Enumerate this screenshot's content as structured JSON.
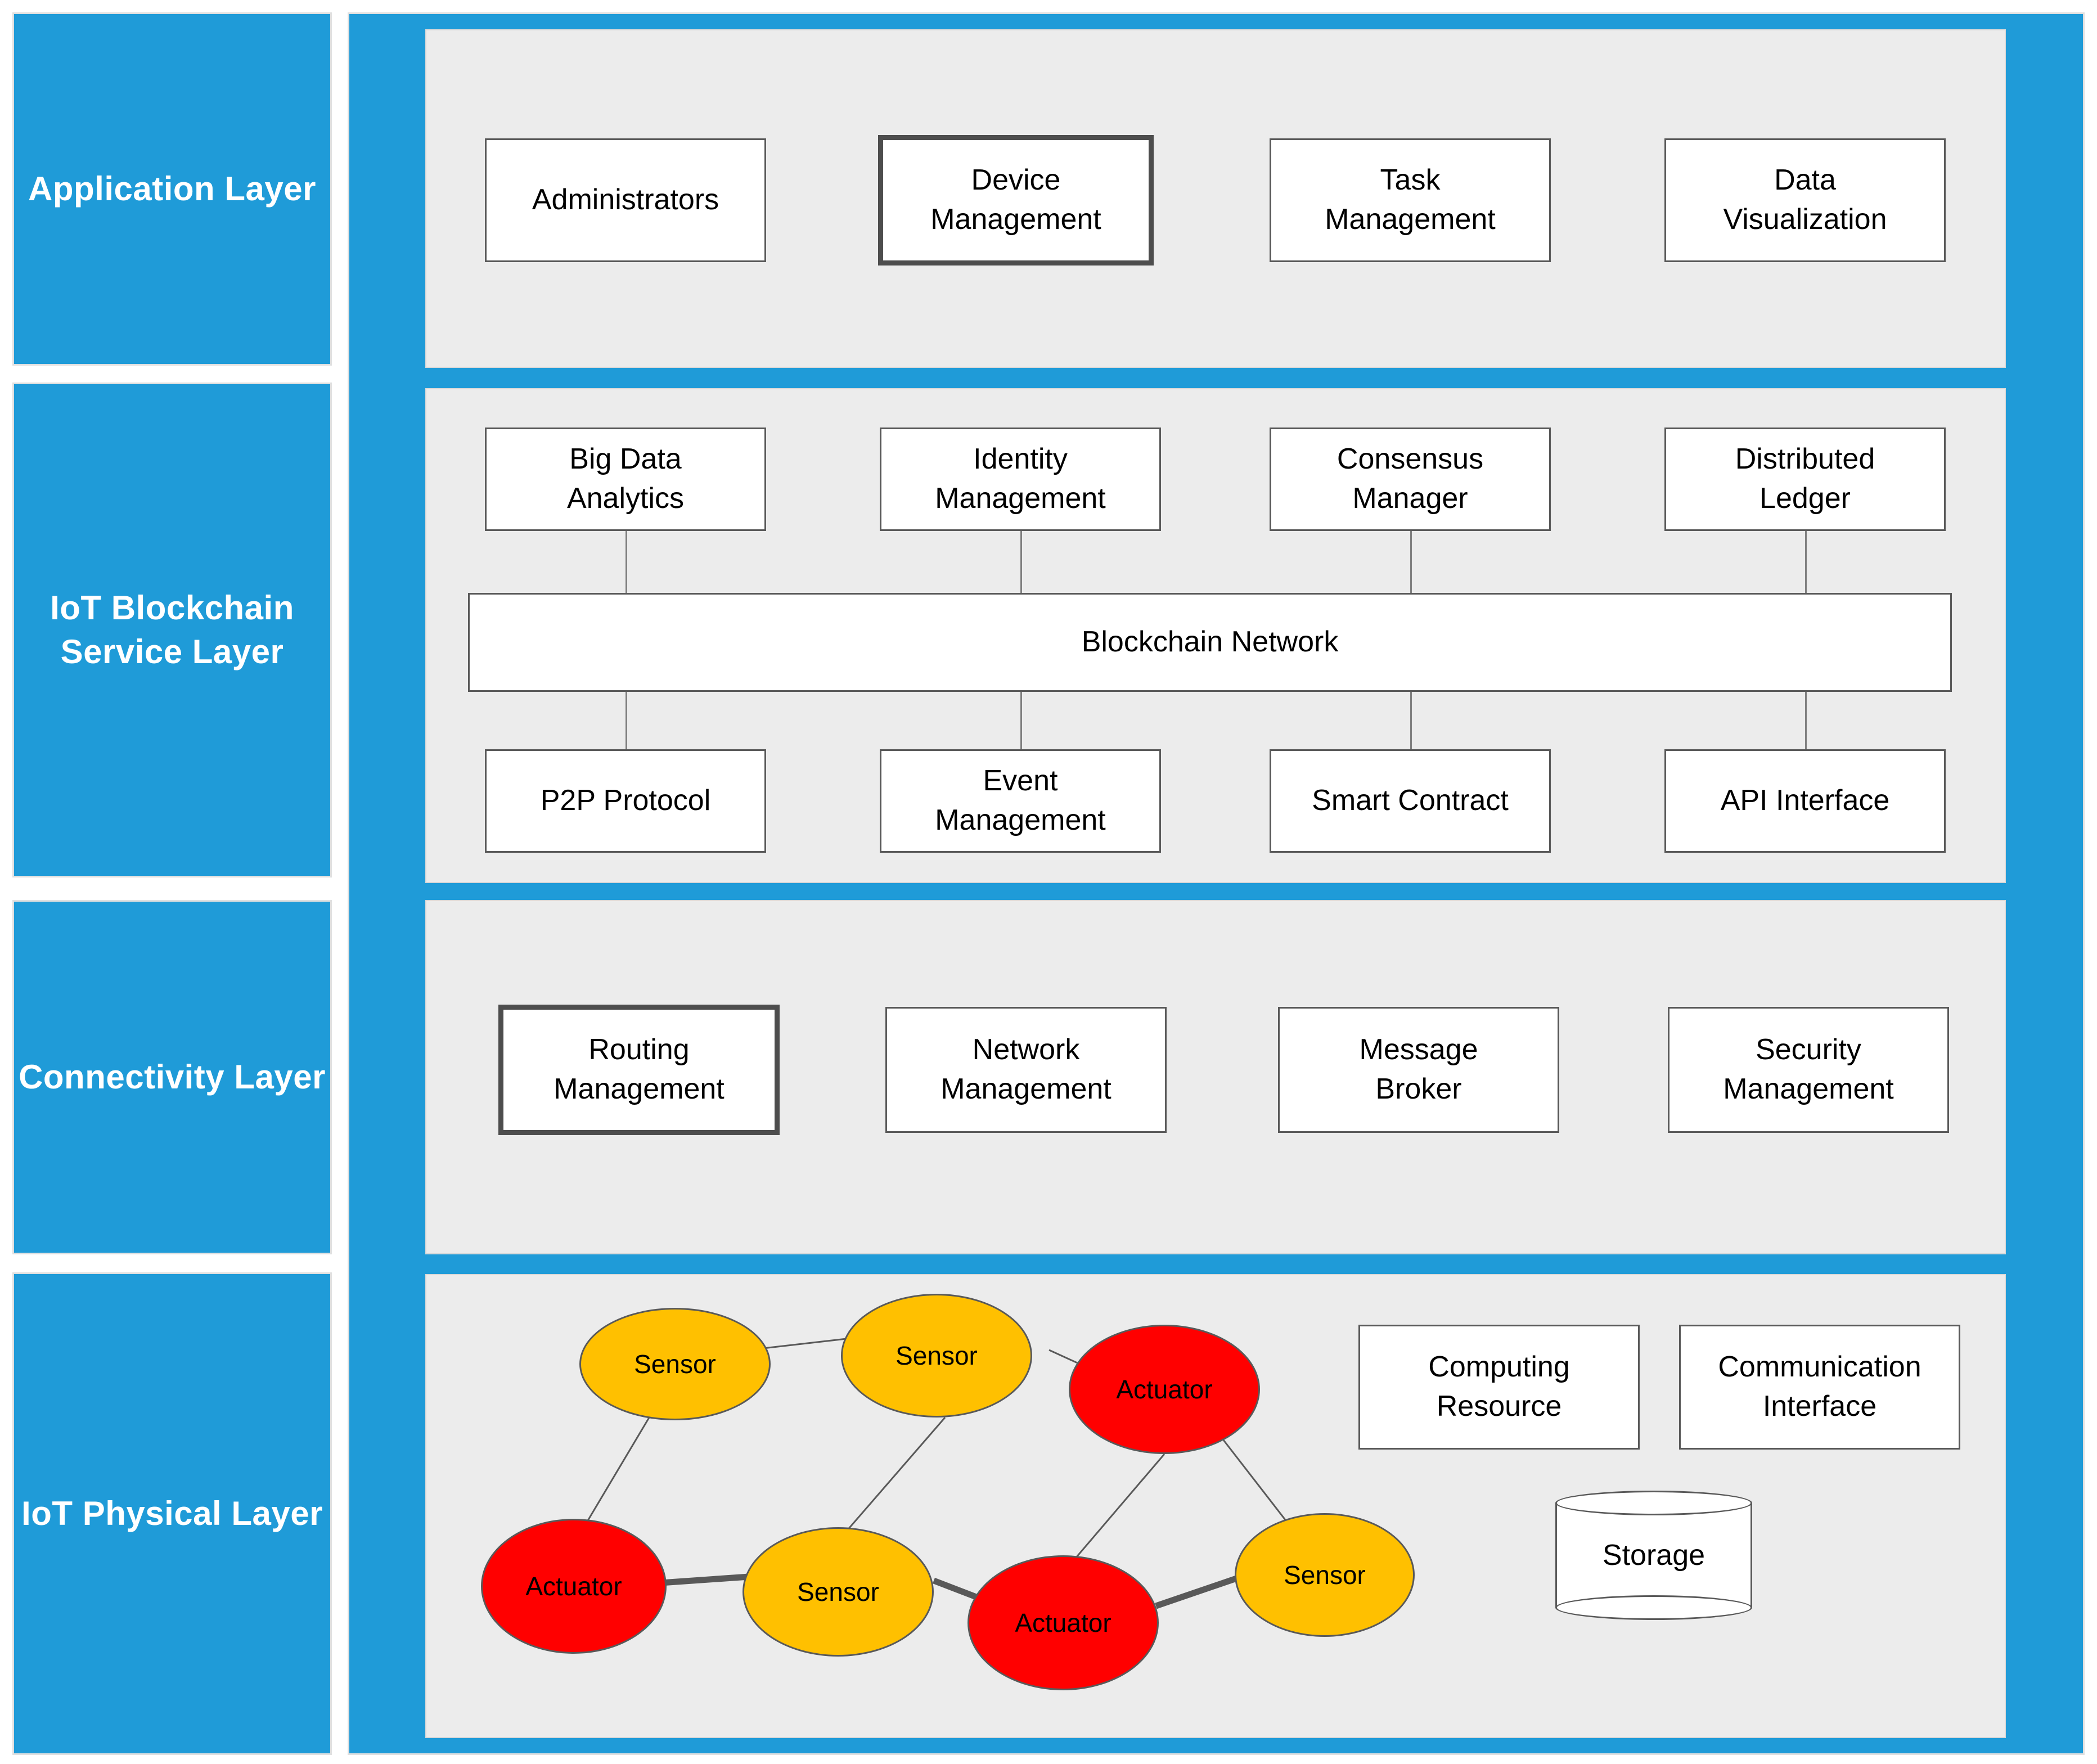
{
  "colors": {
    "layer_blue": "#1F9BD8",
    "panel_gray": "#ececec",
    "box_border": "#595959",
    "box_border_emphasis": "#4d4d4d",
    "sensor_fill": "#FFC000",
    "actuator_fill": "#FF0000",
    "connector": "#7f7f7f"
  },
  "sidebar": {
    "layers": [
      {
        "label": "Application\nLayer"
      },
      {
        "label": "IoT Blockchain\nService Layer"
      },
      {
        "label": "Connectivity\nLayer"
      },
      {
        "label": "IoT\nPhysical\nLayer"
      }
    ]
  },
  "application_layer": {
    "boxes": [
      {
        "label": "Administrators",
        "emphasized": false
      },
      {
        "label": "Device\nManagement",
        "emphasized": true
      },
      {
        "label": "Task\nManagement",
        "emphasized": false
      },
      {
        "label": "Data\nVisualization",
        "emphasized": false
      }
    ]
  },
  "blockchain_service_layer": {
    "top_boxes": [
      {
        "label": "Big Data\nAnalytics",
        "emphasized": false
      },
      {
        "label": "Identity\nManagement",
        "emphasized": false
      },
      {
        "label": "Consensus\nManager",
        "emphasized": false
      },
      {
        "label": "Distributed\nLedger",
        "emphasized": false
      }
    ],
    "bus": {
      "label": "Blockchain Network"
    },
    "bottom_boxes": [
      {
        "label": "P2P Protocol",
        "emphasized": false
      },
      {
        "label": "Event\nManagement",
        "emphasized": false
      },
      {
        "label": "Smart Contract",
        "emphasized": false
      },
      {
        "label": "API Interface",
        "emphasized": false
      }
    ]
  },
  "connectivity_layer": {
    "boxes": [
      {
        "label": "Routing\nManagement",
        "emphasized": true
      },
      {
        "label": "Network\nManagement",
        "emphasized": false
      },
      {
        "label": "Message\nBroker",
        "emphasized": false
      },
      {
        "label": "Security\nManagement",
        "emphasized": false
      }
    ]
  },
  "physical_layer": {
    "nodes": [
      {
        "id": "s1",
        "label": "Sensor",
        "type": "sensor"
      },
      {
        "id": "s2",
        "label": "Sensor",
        "type": "sensor"
      },
      {
        "id": "a1",
        "label": "Actuator",
        "type": "actuator"
      },
      {
        "id": "a2",
        "label": "Actuator",
        "type": "actuator"
      },
      {
        "id": "s3",
        "label": "Sensor",
        "type": "sensor"
      },
      {
        "id": "a3",
        "label": "Actuator",
        "type": "actuator"
      },
      {
        "id": "s4",
        "label": "Sensor",
        "type": "sensor"
      }
    ],
    "edges": [
      {
        "from": "s1",
        "to": "s2",
        "weight": "thin"
      },
      {
        "from": "s2",
        "to": "a1",
        "weight": "thin"
      },
      {
        "from": "s1",
        "to": "a2",
        "weight": "thin"
      },
      {
        "from": "s2",
        "to": "s3",
        "weight": "thin"
      },
      {
        "from": "a1",
        "to": "a3",
        "weight": "thin"
      },
      {
        "from": "a1",
        "to": "s4",
        "weight": "thin"
      },
      {
        "from": "a2",
        "to": "s3",
        "weight": "thick"
      },
      {
        "from": "s3",
        "to": "a3",
        "weight": "thick"
      },
      {
        "from": "a3",
        "to": "s4",
        "weight": "thick"
      }
    ],
    "boxes": [
      {
        "label": "Computing\nResource"
      },
      {
        "label": "Communication\nInterface"
      }
    ],
    "storage": {
      "label": "Storage"
    }
  }
}
